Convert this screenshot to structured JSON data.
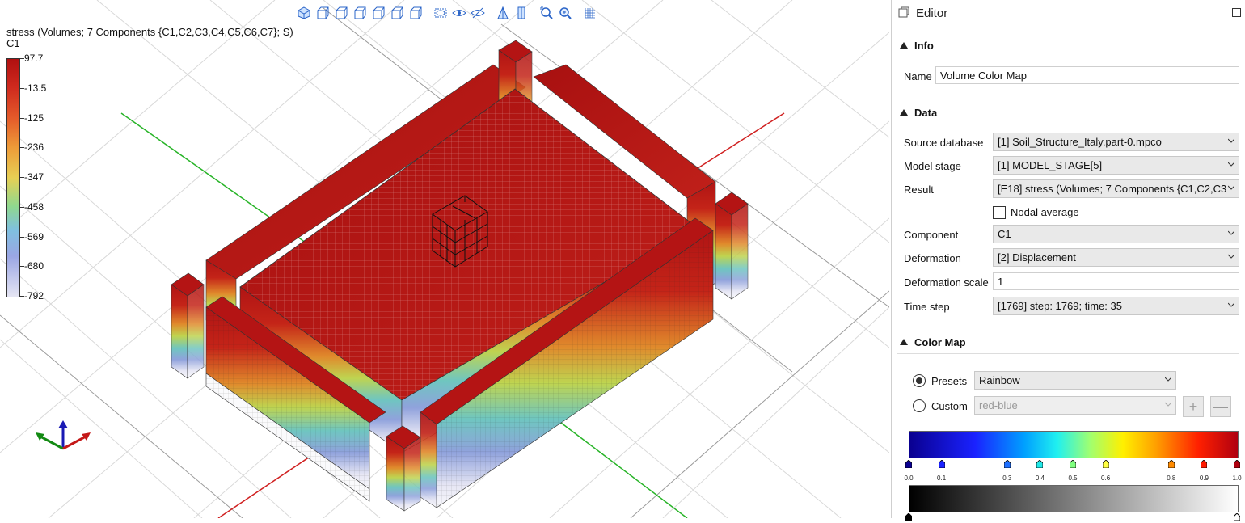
{
  "viewport": {
    "legend": {
      "title": "stress (Volumes; 7 Components {C1,C2,C3,C4,C5,C6,C7}; S)",
      "component": "C1",
      "labels": [
        "97.7",
        "-13.5",
        "-125",
        "-236",
        "-347",
        "-458",
        "-569",
        "-680",
        "-792"
      ]
    },
    "toolbar_icons": [
      "view-iso-icon",
      "view-front-icon",
      "view-back-icon",
      "view-left-icon",
      "view-right-icon",
      "view-top-icon",
      "view-bottom-icon",
      "hide-icon",
      "show-icon",
      "hide-all-icon",
      "perspective-icon",
      "parallel-icon",
      "zoom-fit-icon",
      "zoom-icon",
      "grid-icon"
    ]
  },
  "editor": {
    "title": "Editor",
    "info": {
      "header": "Info",
      "name_label": "Name",
      "name_value": "Volume Color Map"
    },
    "data": {
      "header": "Data",
      "source_label": "Source database",
      "source_value": "[1] Soil_Structure_Italy.part-0.mpco",
      "stage_label": "Model stage",
      "stage_value": "[1] MODEL_STAGE[5]",
      "result_label": "Result",
      "result_value": "[E18] stress (Volumes; 7 Components {C1,C2,C3",
      "nodal_label": "Nodal average",
      "component_label": "Component",
      "component_value": "C1",
      "deformation_label": "Deformation",
      "deformation_value": "[2] Displacement",
      "scale_label": "Deformation scale",
      "scale_value": "1",
      "timestep_label": "Time step",
      "timestep_value": "[1769] step: 1769; time: 35"
    },
    "colormap": {
      "header": "Color Map",
      "presets_label": "Presets",
      "presets_value": "Rainbow",
      "custom_label": "Custom",
      "custom_value": "red-blue",
      "stops": [
        "0.0",
        "0.1",
        "0.3",
        "0.4",
        "0.5",
        "0.6",
        "0.8",
        "0.9",
        "1.0"
      ],
      "stop_colors": [
        "#0a0090",
        "#1a22ff",
        "#1e6fff",
        "#20e8e8",
        "#80ff80",
        "#ffff40",
        "#ff8a00",
        "#ff1a00",
        "#b00010"
      ]
    }
  }
}
